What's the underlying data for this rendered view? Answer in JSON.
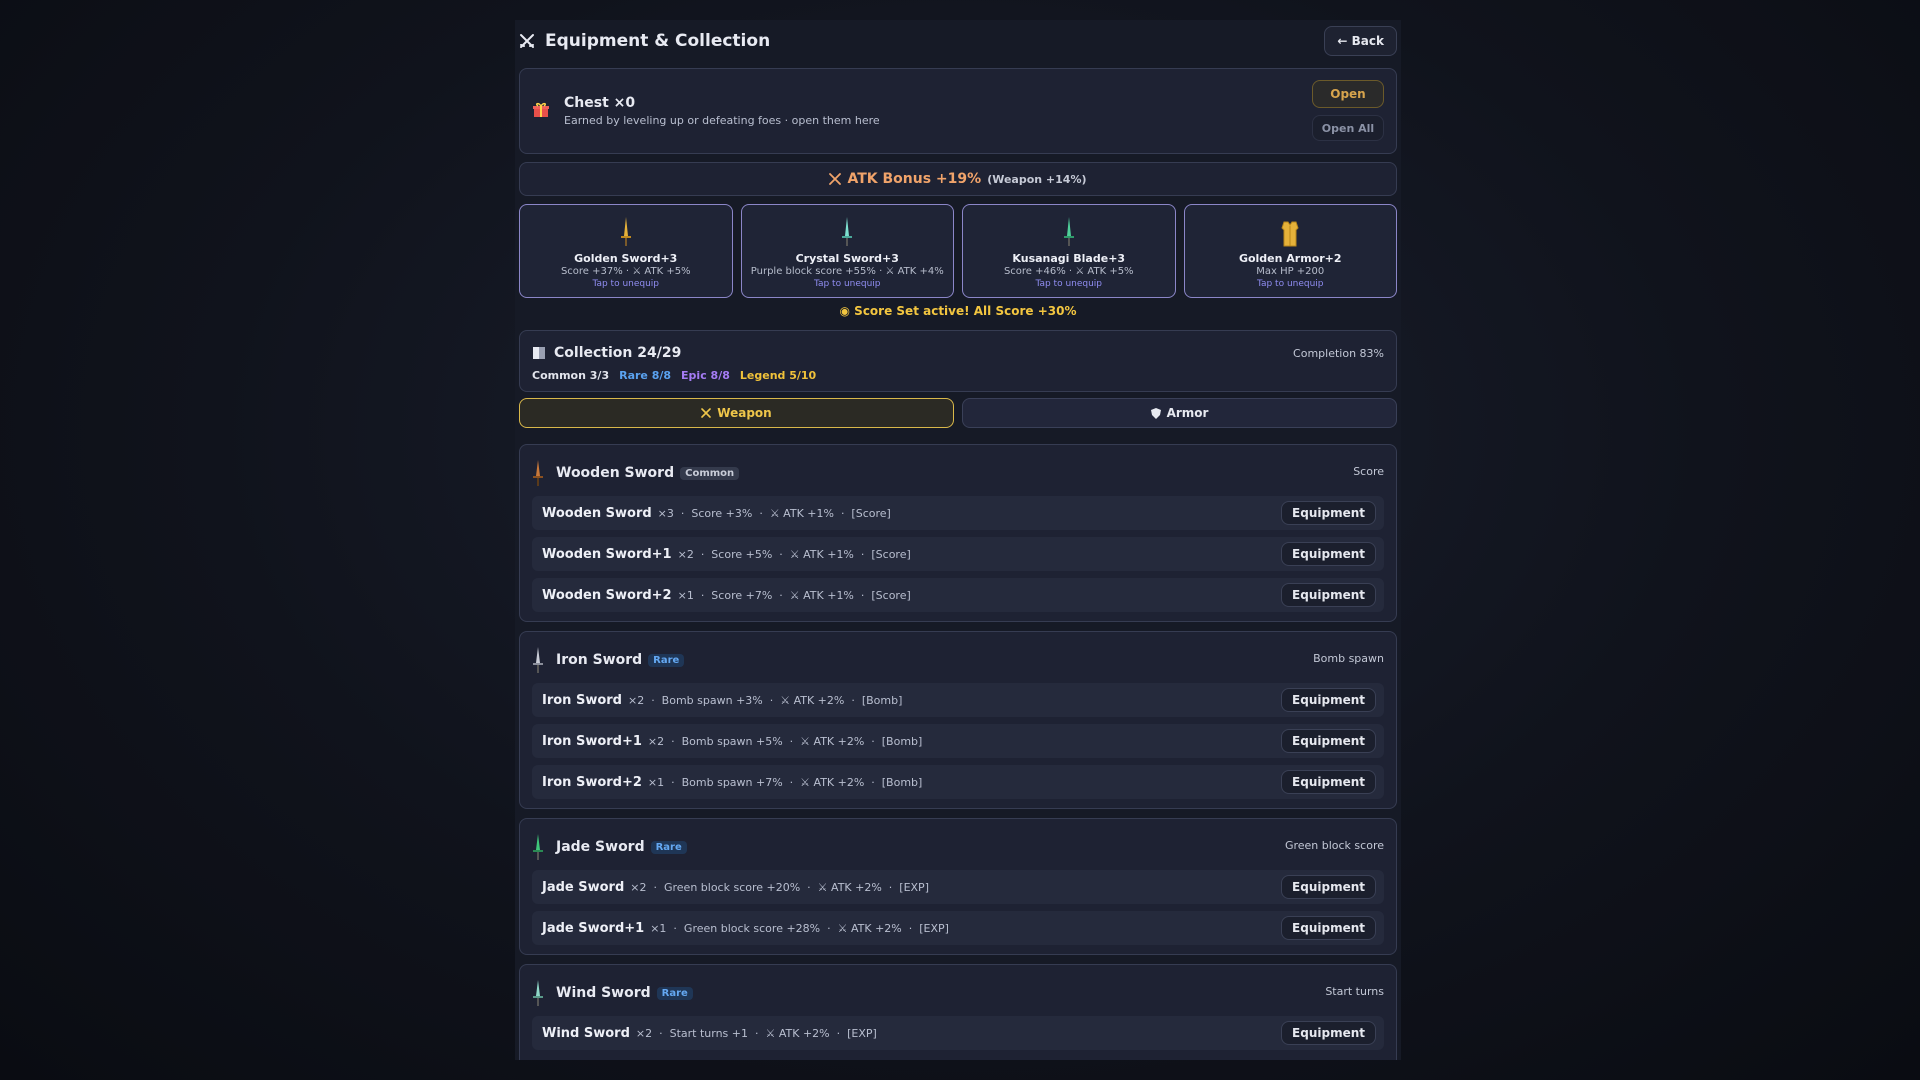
{
  "header": {
    "title": "Equipment & Collection",
    "back_label": "← Back"
  },
  "chest": {
    "name": "Chest ×0",
    "desc": "Earned by leveling up or defeating foes  ·  open them here",
    "open_label": "Open",
    "open_all_label": "Open All"
  },
  "atk_bonus": {
    "main": "ATK Bonus +19%",
    "sub": "(Weapon +14%)"
  },
  "equipped": [
    {
      "name": "Golden Sword+3",
      "stat": "Score +37%  ·  ⚔ ATK +5%",
      "tap": "Tap to unequip",
      "icon": "golden-sword-icon",
      "color": "#e6b23a"
    },
    {
      "name": "Crystal Sword+3",
      "stat": "Purple block score +55%  ·  ⚔ ATK +4%",
      "tap": "Tap to unequip",
      "icon": "crystal-sword-icon",
      "color": "#7ee0d0"
    },
    {
      "name": "Kusanagi Blade+3",
      "stat": "Score +46%  ·  ⚔ ATK +5%",
      "tap": "Tap to unequip",
      "icon": "kusanagi-blade-icon",
      "color": "#4fd09a"
    },
    {
      "name": "Golden Armor+2",
      "stat": "Max HP +200",
      "tap": "Tap to unequip",
      "icon": "golden-armor-icon",
      "color": "#e6b23a"
    }
  ],
  "set_bonus": "Score Set active! All Score +30%",
  "collection": {
    "title": "Collection 24/29",
    "completion": "Completion 83%",
    "counts": [
      {
        "label": "Common 3/3",
        "color": "#e2e4ec"
      },
      {
        "label": "Rare 8/8",
        "color": "#5aa2f0"
      },
      {
        "label": "Epic 8/8",
        "color": "#a57cf5"
      },
      {
        "label": "Legend 5/10",
        "color": "#f0c23a"
      }
    ]
  },
  "tabs": {
    "weapon": "Weapon",
    "armor": "Armor"
  },
  "groups": [
    {
      "name": "Wooden Sword",
      "rarity": "Common",
      "tag": "Score",
      "color": "#c8783a",
      "items": [
        {
          "name": "Wooden Sword",
          "rest": "×3  ·  Score +3%  ·  ⚔ ATK +1%  ·  [Score]",
          "button": "Equipment"
        },
        {
          "name": "Wooden Sword+1",
          "rest": "×2  ·  Score +5%  ·  ⚔ ATK +1%  ·  [Score]",
          "button": "Equipment"
        },
        {
          "name": "Wooden Sword+2",
          "rest": "×1  ·  Score +7%  ·  ⚔ ATK +1%  ·  [Score]",
          "button": "Equipment"
        }
      ]
    },
    {
      "name": "Iron Sword",
      "rarity": "Rare",
      "tag": "Bomb spawn",
      "color": "#c9ccd6",
      "items": [
        {
          "name": "Iron Sword",
          "rest": "×2  ·  Bomb spawn +3%  ·  ⚔ ATK +2%  ·  [Bomb]",
          "button": "Equipment"
        },
        {
          "name": "Iron Sword+1",
          "rest": "×2  ·  Bomb spawn +5%  ·  ⚔ ATK +2%  ·  [Bomb]",
          "button": "Equipment"
        },
        {
          "name": "Iron Sword+2",
          "rest": "×1  ·  Bomb spawn +7%  ·  ⚔ ATK +2%  ·  [Bomb]",
          "button": "Equipment"
        }
      ]
    },
    {
      "name": "Jade Sword",
      "rarity": "Rare",
      "tag": "Green block score",
      "color": "#3fc77a",
      "items": [
        {
          "name": "Jade Sword",
          "rest": "×2  ·  Green block score +20%  ·  ⚔ ATK +2%  ·  [EXP]",
          "button": "Equipment"
        },
        {
          "name": "Jade Sword+1",
          "rest": "×1  ·  Green block score +28%  ·  ⚔ ATK +2%  ·  [EXP]",
          "button": "Equipment"
        }
      ]
    },
    {
      "name": "Wind Sword",
      "rarity": "Rare",
      "tag": "Start turns",
      "color": "#8fd8c8",
      "items": [
        {
          "name": "Wind Sword",
          "rest": "×2  ·  Start turns +1  ·  ⚔ ATK +2%  ·  [EXP]",
          "button": "Equipment"
        }
      ]
    }
  ]
}
